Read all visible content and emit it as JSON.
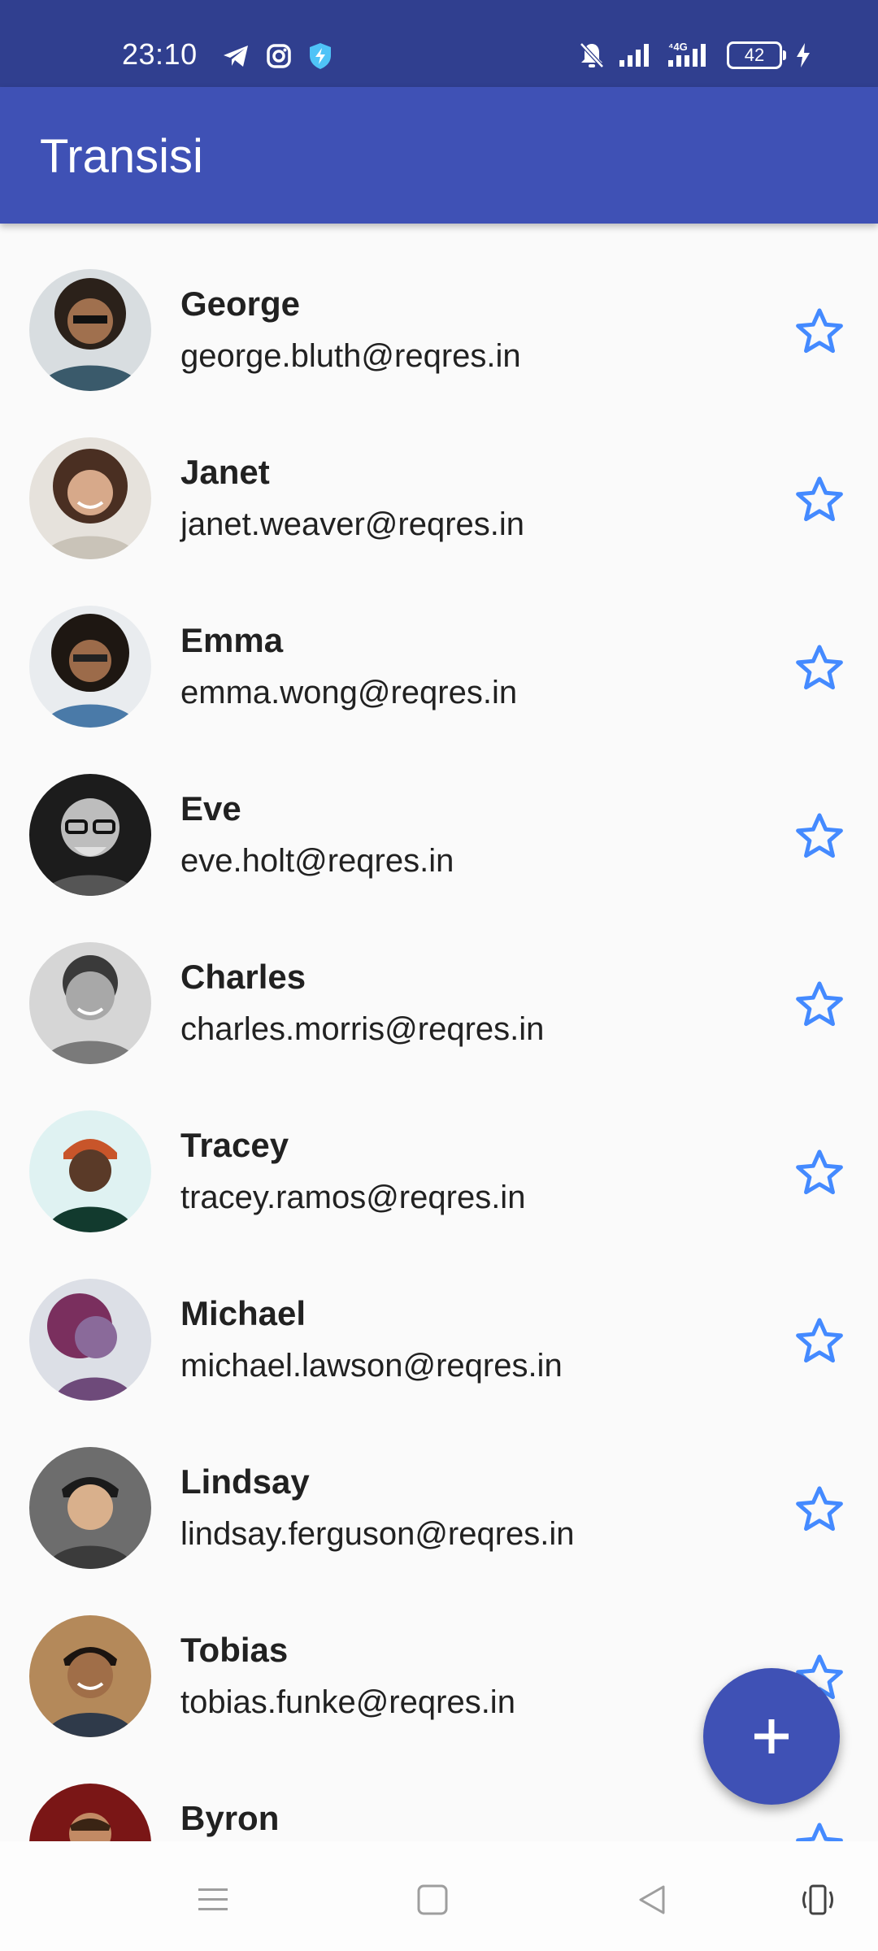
{
  "status_bar": {
    "time": "23:10",
    "battery": "42",
    "icons_left": [
      "telegram-icon",
      "instagram-icon",
      "shield-bolt-icon"
    ],
    "icons_right": [
      "bell-off-icon",
      "signal-icon",
      "signal-4g-icon",
      "battery-icon",
      "charging-icon"
    ]
  },
  "app_bar": {
    "title": "Transisi"
  },
  "colors": {
    "status_bar": "#303f8f",
    "primary": "#3f51b5",
    "star": "#448aff",
    "background": "#fafafa"
  },
  "users": [
    {
      "name": "George",
      "email": "george.bluth@reqres.in"
    },
    {
      "name": "Janet",
      "email": "janet.weaver@reqres.in"
    },
    {
      "name": "Emma",
      "email": "emma.wong@reqres.in"
    },
    {
      "name": "Eve",
      "email": "eve.holt@reqres.in"
    },
    {
      "name": "Charles",
      "email": "charles.morris@reqres.in"
    },
    {
      "name": "Tracey",
      "email": "tracey.ramos@reqres.in"
    },
    {
      "name": "Michael",
      "email": "michael.lawson@reqres.in"
    },
    {
      "name": "Lindsay",
      "email": "lindsay.ferguson@reqres.in"
    },
    {
      "name": "Tobias",
      "email": "tobias.funke@reqres.in"
    },
    {
      "name": "Byron",
      "email": ""
    }
  ],
  "item_icons": {
    "favorite": "star-outline-icon",
    "avatar": "avatar-photo"
  },
  "fab": {
    "icon": "plus-icon"
  },
  "nav_bar": {
    "buttons": [
      "menu-icon",
      "home-icon",
      "back-icon",
      "rotate-icon"
    ]
  }
}
